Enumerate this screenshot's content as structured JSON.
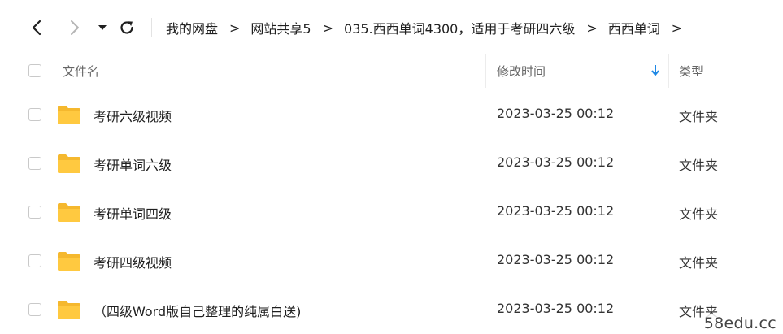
{
  "toolbar": {
    "back_icon": "chevron-left-icon",
    "forward_icon": "chevron-right-icon",
    "history_icon": "caret-down-icon",
    "refresh_icon": "refresh-icon",
    "breadcrumb": [
      "我的网盘",
      "网站共享5",
      "035.西西单词4300，适用于考研四六级",
      "西西单词"
    ],
    "separator": ">",
    "trailing_separator": ">"
  },
  "columns": {
    "name": "文件名",
    "modified": "修改时间",
    "type": "类型",
    "sort_icon": "arrow-down-icon"
  },
  "files": [
    {
      "name": "考研六级视频",
      "modified": "2023-03-25 00:12",
      "type": "文件夹"
    },
    {
      "name": "考研单词六级",
      "modified": "2023-03-25 00:12",
      "type": "文件夹"
    },
    {
      "name": "考研单词四级",
      "modified": "2023-03-25 00:12",
      "type": "文件夹"
    },
    {
      "name": "考研四级视频",
      "modified": "2023-03-25 00:12",
      "type": "文件夹"
    },
    {
      "name": "（四级Word版自己整理的纯属白送)",
      "modified": "2023-03-25 00:12",
      "type": "文件夹"
    }
  ],
  "colors": {
    "folder": "#FFC940",
    "sort_arrow": "#1E88E5"
  },
  "watermark": "58edu.cc"
}
